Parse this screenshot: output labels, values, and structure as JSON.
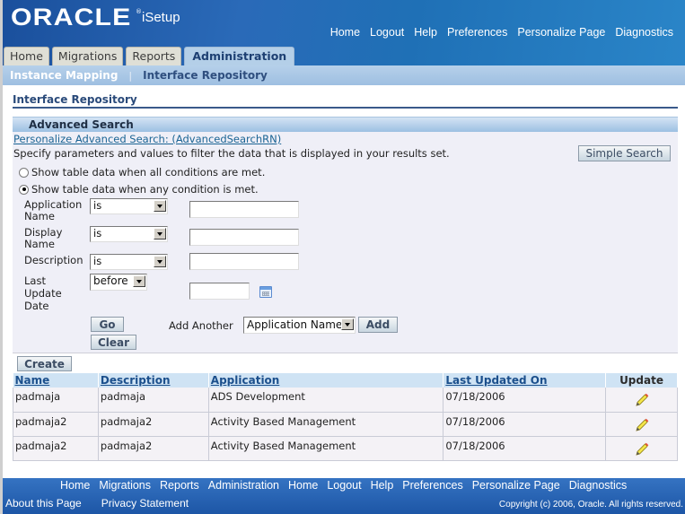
{
  "header": {
    "brand": "ORACLE",
    "brand_reg": "®",
    "product": "iSetup",
    "global_links": [
      "Home",
      "Logout",
      "Help",
      "Preferences",
      "Personalize Page",
      "Diagnostics"
    ]
  },
  "tabs": [
    {
      "label": "Home",
      "active": false
    },
    {
      "label": "Migrations",
      "active": false
    },
    {
      "label": "Reports",
      "active": false
    },
    {
      "label": "Administration",
      "active": true
    }
  ],
  "subnav": {
    "items": [
      "Instance Mapping",
      "Interface Repository"
    ],
    "separator": "|",
    "selected": "Interface Repository"
  },
  "page_title": "Interface Repository",
  "search": {
    "header": "Advanced Search",
    "personalize_link": "Personalize Advanced Search: (AdvancedSearchRN)",
    "instructions": "Specify parameters and values to filter the data that is displayed in your results set.",
    "simple_search_label": "Simple Search",
    "match_options": [
      {
        "label": "Show table data when all conditions are met.",
        "checked": false
      },
      {
        "label": "Show table data when any condition is met.",
        "checked": true
      }
    ],
    "conditions": [
      {
        "label": "Application Name",
        "operator": "is",
        "value": ""
      },
      {
        "label": "Display Name",
        "operator": "is",
        "value": ""
      },
      {
        "label": "Description",
        "operator": "is",
        "value": ""
      },
      {
        "label": "Last Update Date",
        "operator": "before",
        "value": ""
      }
    ],
    "go_label": "Go",
    "clear_label": "Clear",
    "add_another_label": "Add Another",
    "add_another_selected": "Application Name",
    "add_label": "Add"
  },
  "results": {
    "create_label": "Create",
    "columns": [
      "Name",
      "Description",
      "Application",
      "Last Updated On",
      "Update"
    ],
    "rows": [
      {
        "name": "padmaja",
        "description": "padmaja",
        "application": "ADS Development",
        "last_updated": "07/18/2006"
      },
      {
        "name": "padmaja2",
        "description": "padmaja2",
        "application": "Activity Based Management",
        "last_updated": "07/18/2006"
      },
      {
        "name": "padmaja2",
        "description": "padmaja2",
        "application": "Activity Based Management",
        "last_updated": "07/18/2006"
      }
    ],
    "update_icon": "pencil-icon"
  },
  "footer": {
    "links": [
      "Home",
      "Migrations",
      "Reports",
      "Administration",
      "Home",
      "Logout",
      "Help",
      "Preferences",
      "Personalize Page",
      "Diagnostics"
    ],
    "bottom_links": [
      "About this Page",
      "Privacy Statement"
    ],
    "copyright": "Copyright (c) 2006, Oracle. All rights reserved."
  }
}
